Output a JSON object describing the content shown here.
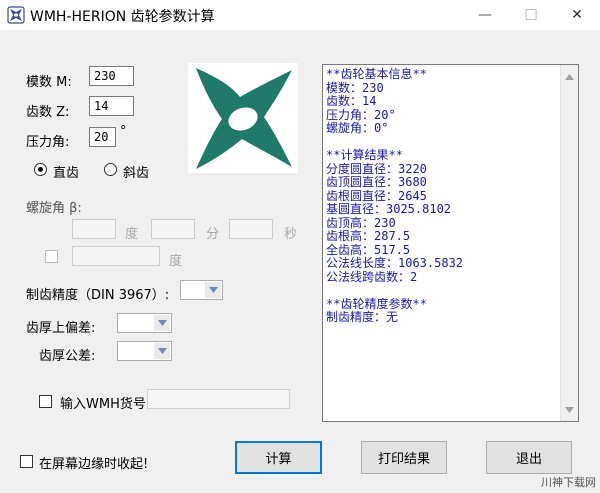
{
  "window": {
    "title": "WMH-HERION 齿轮参数计算",
    "minimize_glyph": "—",
    "maximize_glyph": "☐",
    "close_glyph": "✕"
  },
  "inputs": {
    "module_label": "模数 M:",
    "module_value": "230",
    "teeth_label": "齿数 Z:",
    "teeth_value": "14",
    "pressure_label": "压力角:",
    "pressure_value": "20",
    "pressure_unit": "°"
  },
  "gear_type": {
    "spur_label": "直齿",
    "helical_label": "斜齿",
    "selected": "spur"
  },
  "helix": {
    "label": "螺旋角 β:",
    "deg_unit": "度",
    "min_unit": "分",
    "sec_unit": "秒",
    "decimal_deg_unit": "度"
  },
  "precision": {
    "label": "制齿精度（DIN 3967）:",
    "upper_dev_label": "齿厚上偏差:",
    "tolerance_label": "齿厚公差:"
  },
  "wmh_part": {
    "label": "输入WMH货号"
  },
  "result_lines": [
    "**齿轮基本信息**",
    "模数：230",
    "齿数：14",
    "压力角：20°",
    "螺旋角：0°",
    "",
    "**计算结果**",
    "分度圆直径：3220",
    "齿顶圆直径：3680",
    "齿根圆直径：2645",
    "基圆直径：3025.8102",
    "齿顶高：230",
    "齿根高：287.5",
    "全齿高：517.5",
    "公法线长度：1063.5832",
    "公法线跨齿数：2",
    "",
    "**齿轮精度参数**",
    "制齿精度：无"
  ],
  "footer": {
    "collapse_label": "在屏幕边缘时收起!",
    "calc_label": "计算",
    "print_label": "打印结果",
    "exit_label": "退出"
  },
  "watermark": "川神下载网",
  "colors": {
    "logo": "#1f7a6a",
    "result_text": "#1a1ab0",
    "default_button_border": "#0078d7"
  },
  "icons": [
    "app-icon",
    "minimize-icon",
    "maximize-icon",
    "close-icon",
    "company-logo",
    "combo-arrow-icon",
    "scroll-up-arrow-icon",
    "scroll-down-arrow-icon"
  ]
}
